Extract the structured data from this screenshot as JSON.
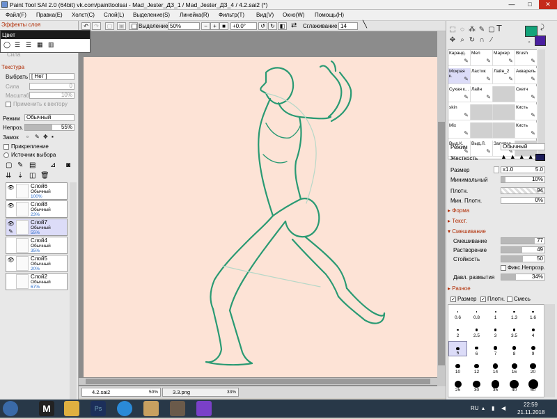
{
  "window": {
    "title": "Paint Tool SAI 2.0 (64bit) vk.com/painttoolsai - Mad_Jester_ДЗ_1 / Mad_Jester_ДЗ_4 / 4.2.sai2 (*)",
    "min": "—",
    "max": "□",
    "close": "✕"
  },
  "menu": [
    "Файл(F)",
    "Правка(E)",
    "Холст(C)",
    "Слой(L)",
    "Выделение(S)",
    "Линейка(R)",
    "Фильтр(T)",
    "Вид(V)",
    "Окно(W)",
    "Помощь(H)"
  ],
  "toolbar": {
    "selection_label": "Выделение",
    "zoom": "50%",
    "zoom_minus": "−",
    "zoom_plus": "+",
    "zoom_reset": "■",
    "rotation": "+0.0°",
    "smoothing_label": "Сглаживание",
    "smoothing": "14"
  },
  "left": {
    "layer_effects": "Эффекты слоя",
    "color_popup": "Цвет",
    "strength_faded": "Сила",
    "texture_header": "Текстура",
    "select_label": "Выбрать",
    "texture_value": "[ Нет ]",
    "tex_strength": "Сила",
    "tex_strength_val": "0",
    "tex_scale": "Масштаб",
    "tex_scale_val": "10%",
    "apply_vector": "Применить к вектору",
    "mode_label": "Режим",
    "mode_value": "Обычный",
    "opacity_label": "Непроз.",
    "opacity_value": "55%",
    "opacity_fraction": 0.55,
    "lock_label": "Замок",
    "clip_label": "Прикрепление",
    "source_label": "Источник выбора"
  },
  "layers": [
    {
      "name": "Слой6",
      "mode": "Обычный",
      "opacity": "100%",
      "visible": true,
      "selected": false
    },
    {
      "name": "Слой8",
      "mode": "Обычный",
      "opacity": "23%",
      "visible": true,
      "selected": false
    },
    {
      "name": "Слой7",
      "mode": "Обычный",
      "opacity": "55%",
      "visible": true,
      "selected": true
    },
    {
      "name": "Слой4",
      "mode": "Обычный",
      "opacity": "35%",
      "visible": false,
      "selected": false
    },
    {
      "name": "Слой5",
      "mode": "Обычный",
      "opacity": "20%",
      "visible": true,
      "selected": false
    },
    {
      "name": "Слой2",
      "mode": "Обычный",
      "opacity": "67%",
      "visible": false,
      "selected": false
    }
  ],
  "doc_tabs": [
    {
      "name": "4.2.sai2",
      "zoom": "50%"
    },
    {
      "name": "3.3.png",
      "zoom": "33%"
    }
  ],
  "colors": {
    "primary": "#13a37a",
    "secondary": "#4a1fa0",
    "stroke": "#2a9a73"
  },
  "brushes": [
    [
      "Каранд.",
      "Мел",
      "Маркер",
      "Brush"
    ],
    [
      "Мокрая к.",
      "Ластик",
      "Лайн_2",
      "Акварель"
    ],
    [
      "Сухая к...",
      "Лайн",
      "",
      "Скетч"
    ],
    [
      "skin",
      "",
      "",
      "Кисть"
    ],
    [
      "Mix",
      "",
      "",
      "Кисть"
    ],
    [
      "Выд.К.",
      "Выд.Л.",
      "Заливка",
      ""
    ]
  ],
  "right": {
    "mode_label": "Режим",
    "mode_value": "Обычный",
    "hardness_label": "Жесткость",
    "size_label": "Размер",
    "size_mult": "x1.0",
    "size_value": "5.0",
    "min_label": "Минимальный",
    "min_value": "10%",
    "density_label": "Плотн.",
    "density_value": "94",
    "min_density_label": "Мин. Плотн.",
    "min_density_value": "0%",
    "form_header": "Форма",
    "text_header": "Текст.",
    "blend_header": "Смешивание",
    "blend_label": "Смешивание",
    "blend_value": "77",
    "dilution_label": "Растворение",
    "dilution_value": "49",
    "persist_label": "Стойкость",
    "persist_value": "50",
    "keep_opacity": "Фикс.Непрозр.",
    "blur_label": "Давл. размытия",
    "blur_value": "34%",
    "misc_header": "Разное",
    "chk_size": "Размер",
    "chk_density": "Плотн.",
    "chk_mix": "Смесь"
  },
  "sizes": [
    "0.6",
    "0.8",
    "1",
    "1.3",
    "1.6",
    "2",
    "2.5",
    "3",
    "3.5",
    "4",
    "5",
    "6",
    "7",
    "8",
    "9",
    "10",
    "12",
    "14",
    "16",
    "20",
    "25",
    "30",
    "35",
    "40",
    "50"
  ],
  "selected_size": "5",
  "taskbar": {
    "lang": "RU",
    "time": "22:59",
    "date": "21.11.2018"
  }
}
